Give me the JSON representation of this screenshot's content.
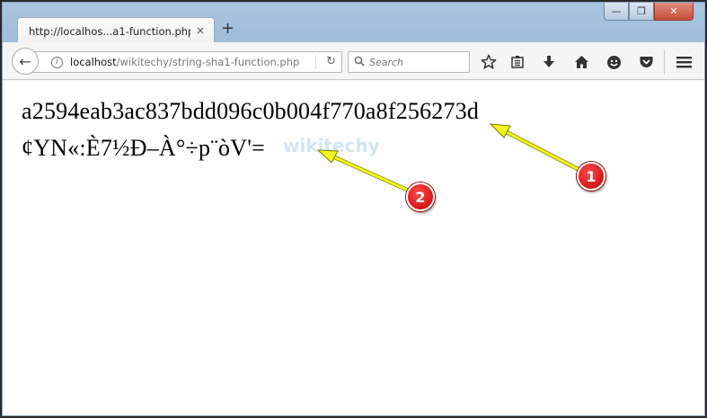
{
  "browser": {
    "tab_title": "http://localhos...a1-function.php",
    "tab_close": "×",
    "new_tab": "+",
    "window_controls": {
      "minimize": "—",
      "restore": "❐",
      "close": "✕"
    },
    "nav": {
      "back": "←",
      "url_host": "localhost",
      "url_path": "/wikitechy/string-sha1-function.php",
      "reload": "↻",
      "search_placeholder": "Search"
    },
    "toolbar_icons": [
      "star-icon",
      "reading-list-icon",
      "download-icon",
      "home-icon",
      "hello-icon",
      "pocket-icon",
      "menu-icon"
    ]
  },
  "content": {
    "line1": "a2594eab3ac837bdd096c0b004f770a8f256273d",
    "line2": "¢YN«:È7½Ð–À°÷p¨òV'=",
    "watermark": "wikitechy"
  },
  "annotations": {
    "badge1": "1",
    "badge2": "2",
    "colors": {
      "badge": "#d00000",
      "arrow": "#f5f51a"
    }
  }
}
